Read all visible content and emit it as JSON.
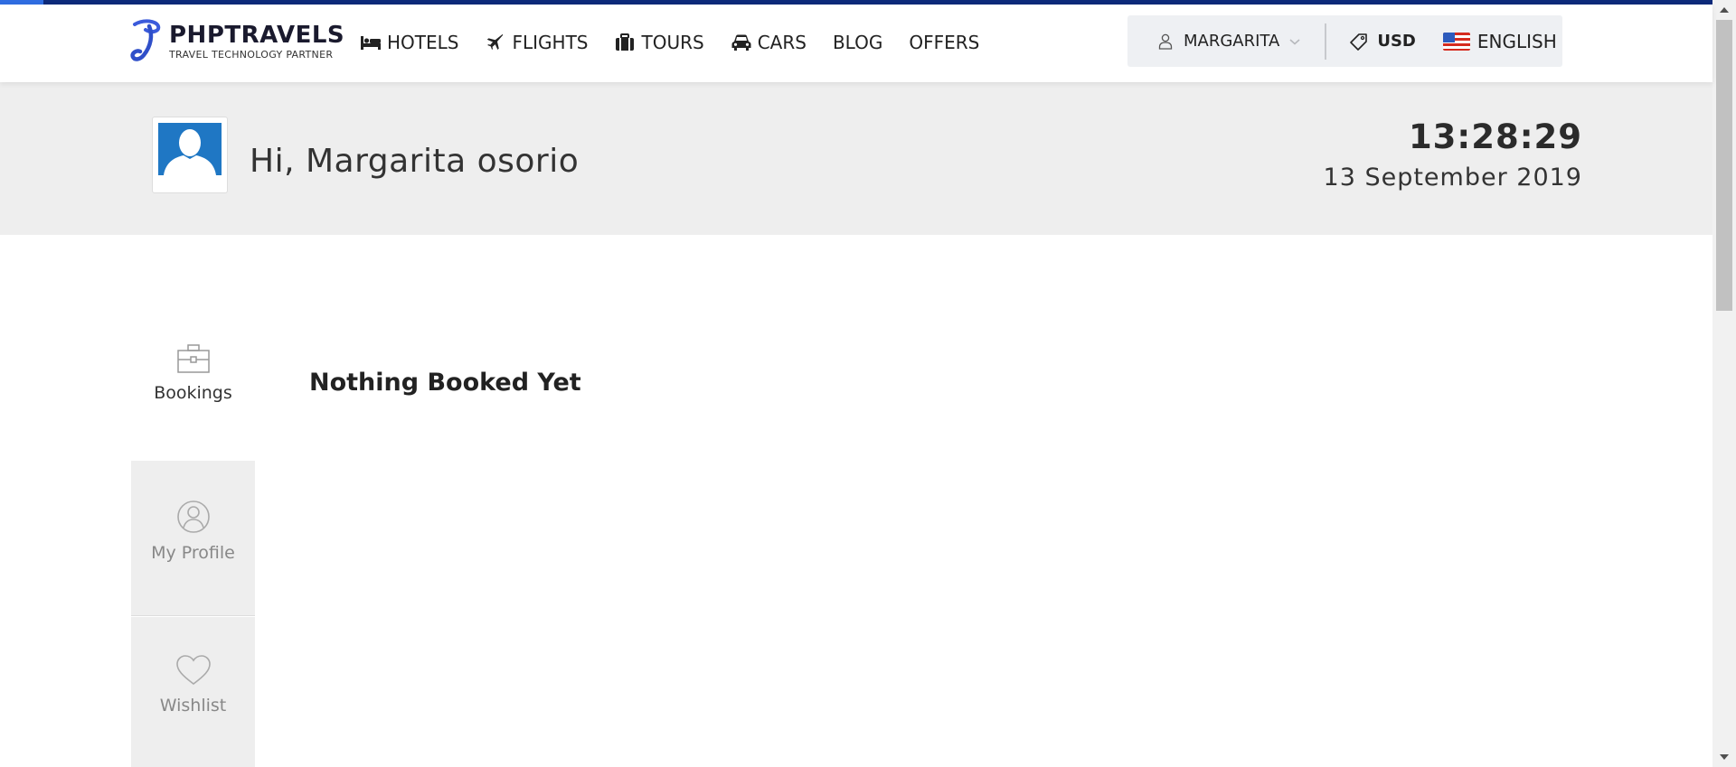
{
  "brand": {
    "name": "PHPTRAVELS",
    "tagline": "TRAVEL TECHNOLOGY PARTNER",
    "color": "#3b5bdb"
  },
  "nav": {
    "items": [
      {
        "label": "HOTELS",
        "icon": "bed-icon"
      },
      {
        "label": "FLIGHTS",
        "icon": "plane-icon"
      },
      {
        "label": "TOURS",
        "icon": "suitcase-icon"
      },
      {
        "label": "CARS",
        "icon": "car-icon"
      },
      {
        "label": "BLOG",
        "icon": ""
      },
      {
        "label": "OFFERS",
        "icon": ""
      }
    ]
  },
  "account": {
    "user_label": "MARGARITA",
    "currency": "USD",
    "language": "ENGLISH"
  },
  "banner": {
    "greeting": "Hi, Margarita osorio",
    "time": "13:28:29",
    "date": "13 September 2019"
  },
  "sidebar": {
    "tabs": [
      {
        "label": "Bookings",
        "icon": "briefcase-icon",
        "active": true
      },
      {
        "label": "My Profile",
        "icon": "user-circle-icon",
        "active": false
      },
      {
        "label": "Wishlist",
        "icon": "heart-icon",
        "active": false
      }
    ]
  },
  "main": {
    "empty_message": "Nothing Booked Yet"
  },
  "colors": {
    "accent_bar": "#0d2a7a",
    "banner_bg": "#eeeeee",
    "avatar_blue": "#1f77c4"
  }
}
